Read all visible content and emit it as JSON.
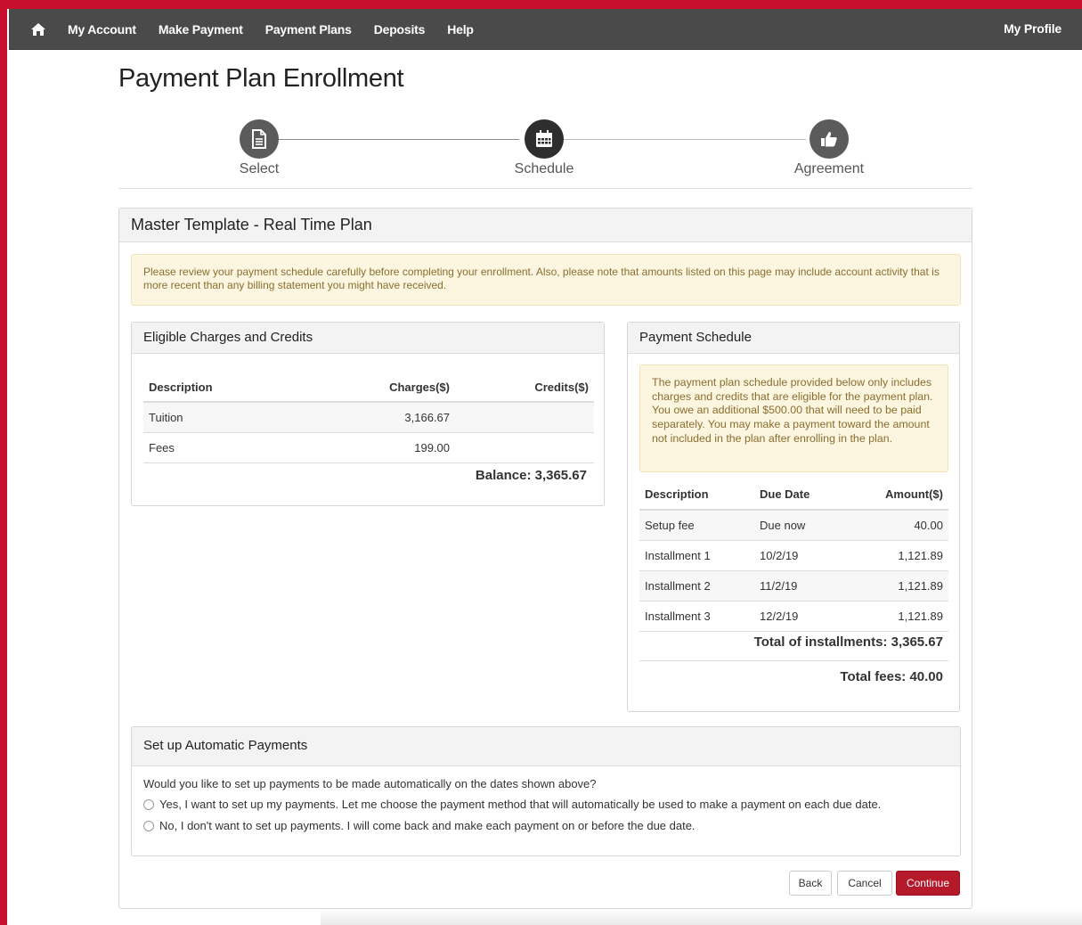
{
  "nav": {
    "items": [
      "My Account",
      "Make Payment",
      "Payment Plans",
      "Deposits",
      "Help"
    ],
    "profile": "My Profile"
  },
  "page_title": "Payment Plan Enrollment",
  "stepper": {
    "steps": [
      {
        "label": "Select",
        "icon": "document-icon"
      },
      {
        "label": "Schedule",
        "icon": "calendar-icon",
        "active": true
      },
      {
        "label": "Agreement",
        "icon": "thumbs-up-icon"
      }
    ]
  },
  "plan": {
    "title": "Master Template - Real Time Plan",
    "notice": "Please review your payment schedule carefully before completing your enrollment. Also, please note that amounts listed on this page may include account activity that is more recent than any billing statement you might have received."
  },
  "charges": {
    "heading": "Eligible Charges and Credits",
    "columns": [
      "Description",
      "Charges($)",
      "Credits($)"
    ],
    "rows": [
      {
        "description": "Tuition",
        "charges": "3,166.67",
        "credits": ""
      },
      {
        "description": "Fees",
        "charges": "199.00",
        "credits": ""
      }
    ],
    "balance": "Balance: 3,365.67"
  },
  "schedule": {
    "heading": "Payment Schedule",
    "notice": "The payment plan schedule provided below only includes charges and credits that are eligible for the payment plan. You owe an additional $500.00 that will need to be paid separately. You may make a payment toward the amount not included in the plan after enrolling in the plan.",
    "columns": [
      "Description",
      "Due Date",
      "Amount($)"
    ],
    "rows": [
      {
        "description": "Setup fee",
        "due": "Due now",
        "amount": "40.00"
      },
      {
        "description": "Installment 1",
        "due": "10/2/19",
        "amount": "1,121.89"
      },
      {
        "description": "Installment 2",
        "due": "11/2/19",
        "amount": "1,121.89"
      },
      {
        "description": "Installment 3",
        "due": "12/2/19",
        "amount": "1,121.89"
      }
    ],
    "total_installments": "Total of installments: 3,365.67",
    "total_fees": "Total fees: 40.00"
  },
  "auto_pay": {
    "heading": "Set up Automatic Payments",
    "question": "Would you like to set up payments to be made automatically on the dates shown above?",
    "options": [
      "Yes, I want to set up my payments. Let me choose the payment method that will automatically be used to make a payment on each due date.",
      "No, I don't want to set up payments. I will come back and make each payment on or before the due date."
    ]
  },
  "buttons": {
    "back": "Back",
    "cancel": "Cancel",
    "continue": "Continue"
  },
  "colors": {
    "accent": "#b51a2b",
    "navbar": "#4a4a4a",
    "frame": "#c8102e",
    "alert_bg": "#fcf6e0"
  }
}
